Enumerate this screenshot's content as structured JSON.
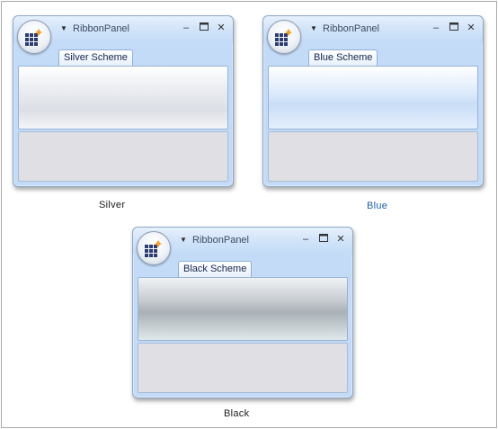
{
  "windows": [
    {
      "title": "RibbonPanel",
      "tab_label": "Silver Scheme",
      "caption": "Silver",
      "caption_color": "#1a1a1a"
    },
    {
      "title": "RibbonPanel",
      "tab_label": "Blue Scheme",
      "caption": "Blue",
      "caption_color": "#1f5fa8"
    },
    {
      "title": "RibbonPanel",
      "tab_label": "Black Scheme",
      "caption": "Black",
      "caption_color": "#1a1a1a"
    }
  ],
  "icons": {
    "app_menu": "app-grid-icon",
    "quick_access": "dropdown-arrow-icon",
    "minimize": "minimize-icon",
    "maximize": "maximize-icon",
    "close": "close-icon"
  },
  "colors": {
    "window_frame": "#c3dbf7",
    "content_area": "#e0dfe3",
    "accent_orange": "#f0a030",
    "grid_dark": "#2c3c6e"
  }
}
